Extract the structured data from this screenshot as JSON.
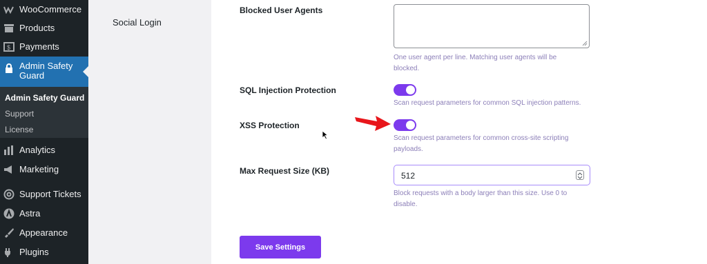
{
  "sidebar": {
    "items": [
      {
        "label": "WooCommerce",
        "icon": "woocommerce-icon"
      },
      {
        "label": "Products",
        "icon": "products-icon"
      },
      {
        "label": "Payments",
        "icon": "payments-icon"
      },
      {
        "label": "Admin Safety Guard",
        "icon": "lock-icon"
      },
      {
        "label": "Analytics",
        "icon": "analytics-icon"
      },
      {
        "label": "Marketing",
        "icon": "megaphone-icon"
      },
      {
        "label": "Support Tickets",
        "icon": "support-icon"
      },
      {
        "label": "Astra",
        "icon": "astra-icon"
      },
      {
        "label": "Appearance",
        "icon": "paintbrush-icon"
      },
      {
        "label": "Plugins",
        "icon": "plugins-icon"
      }
    ],
    "submenu": [
      "Admin Safety Guard",
      "Support",
      "License"
    ],
    "active_label_line1": "Admin Safety",
    "active_label_line2": "Guard"
  },
  "section": {
    "title": "Social Login"
  },
  "form": {
    "blocked_agents": {
      "label": "Blocked User Agents",
      "value": "",
      "help_line1": "One user agent per line. Matching user agents will be",
      "help_line2": "blocked."
    },
    "sql": {
      "label": "SQL Injection Protection",
      "enabled": true,
      "help": "Scan request parameters for common SQL injection patterns."
    },
    "xss": {
      "label": "XSS Protection",
      "enabled": true,
      "help_line1": "Scan request parameters for common cross-site scripting",
      "help_line2": "payloads."
    },
    "max_size": {
      "label": "Max Request Size (KB)",
      "value": "512",
      "help_line1": "Block requests with a body larger than this size. Use 0 to",
      "help_line2": "disable."
    },
    "save_label": "Save Settings"
  },
  "colors": {
    "accent": "#7c3aed",
    "sidebar_bg": "#1d2327",
    "active_bg": "#2271b1",
    "help_text": "#8c7fb8"
  }
}
